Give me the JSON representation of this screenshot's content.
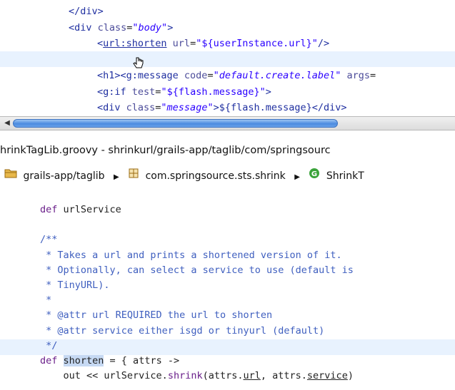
{
  "editor_top": {
    "lines": [
      {
        "parts": [
          {
            "t": "</div>",
            "c": "tag"
          }
        ]
      },
      {
        "parts": [
          {
            "t": "<div ",
            "c": "tag"
          },
          {
            "t": "class",
            "c": "attr"
          },
          {
            "t": "=",
            "c": ""
          },
          {
            "t": "\"body\"",
            "c": "stri"
          },
          {
            "t": ">",
            "c": "tag"
          }
        ]
      },
      {
        "parts": [
          {
            "t": "<",
            "c": "tag"
          },
          {
            "t": "url:shorten",
            "c": "tag u"
          },
          {
            "t": " url",
            "c": "attr"
          },
          {
            "t": "=",
            "c": ""
          },
          {
            "t": "\"${userInstance.url}\"",
            "c": "str"
          },
          {
            "t": "/>",
            "c": "tag"
          }
        ]
      },
      {
        "parts": []
      },
      {
        "parts": [
          {
            "t": "<h1><g:message ",
            "c": "tag"
          },
          {
            "t": "code",
            "c": "attr"
          },
          {
            "t": "=",
            "c": ""
          },
          {
            "t": "\"default.create.label\"",
            "c": "stri"
          },
          {
            "t": " args",
            "c": "attr"
          },
          {
            "t": "=",
            "c": ""
          }
        ]
      },
      {
        "parts": [
          {
            "t": "<g:if ",
            "c": "tag"
          },
          {
            "t": "test",
            "c": "attr"
          },
          {
            "t": "=",
            "c": ""
          },
          {
            "t": "\"${flash.message}\"",
            "c": "str"
          },
          {
            "t": ">",
            "c": "tag"
          }
        ]
      },
      {
        "parts": [
          {
            "t": "<div ",
            "c": "tag"
          },
          {
            "t": "class",
            "c": "attr"
          },
          {
            "t": "=",
            "c": ""
          },
          {
            "t": "\"message\"",
            "c": "stri"
          },
          {
            "t": ">${flash.message}</div>",
            "c": "tag"
          }
        ]
      }
    ]
  },
  "title_bar": "hrinkTagLib.groovy - shrinkurl/grails-app/taglib/com/springsourc",
  "breadcrumb": {
    "items": [
      "grails-app/taglib",
      "com.springsource.sts.shrink",
      "ShrinkT"
    ]
  },
  "editor_bottom": {
    "lines": [
      {
        "parts": [
          {
            "t": "def ",
            "c": "kw"
          },
          {
            "t": "urlService",
            "c": ""
          }
        ]
      },
      {
        "parts": []
      },
      {
        "parts": [
          {
            "t": "/**",
            "c": "cmt"
          }
        ]
      },
      {
        "parts": [
          {
            "t": " * Takes a url and prints a shortened version of it.",
            "c": "cmt"
          }
        ]
      },
      {
        "parts": [
          {
            "t": " * Optionally, can select a service to use (default is",
            "c": "cmt"
          }
        ]
      },
      {
        "parts": [
          {
            "t": " * TinyURL).",
            "c": "cmt"
          }
        ]
      },
      {
        "parts": [
          {
            "t": " *",
            "c": "cmt"
          }
        ]
      },
      {
        "parts": [
          {
            "t": " * @attr url REQUIRED the url to shorten",
            "c": "cmt"
          }
        ]
      },
      {
        "parts": [
          {
            "t": " * @attr service either isgd or tinyurl (default)",
            "c": "cmt"
          }
        ]
      },
      {
        "parts": [
          {
            "t": " */",
            "c": "cmt"
          }
        ]
      },
      {
        "parts": [
          {
            "t": "def ",
            "c": "kw"
          },
          {
            "t": "shorten",
            "c": "sel"
          },
          {
            "t": " = { attrs ->",
            "c": ""
          }
        ]
      },
      {
        "parts": [
          {
            "t": "    out << urlService.",
            "c": ""
          },
          {
            "t": "shrink",
            "c": "kw"
          },
          {
            "t": "(attrs.",
            "c": ""
          },
          {
            "t": "url",
            "c": "u"
          },
          {
            "t": ", attrs.",
            "c": ""
          },
          {
            "t": "service",
            "c": "u"
          },
          {
            "t": ")",
            "c": ""
          }
        ]
      }
    ]
  }
}
